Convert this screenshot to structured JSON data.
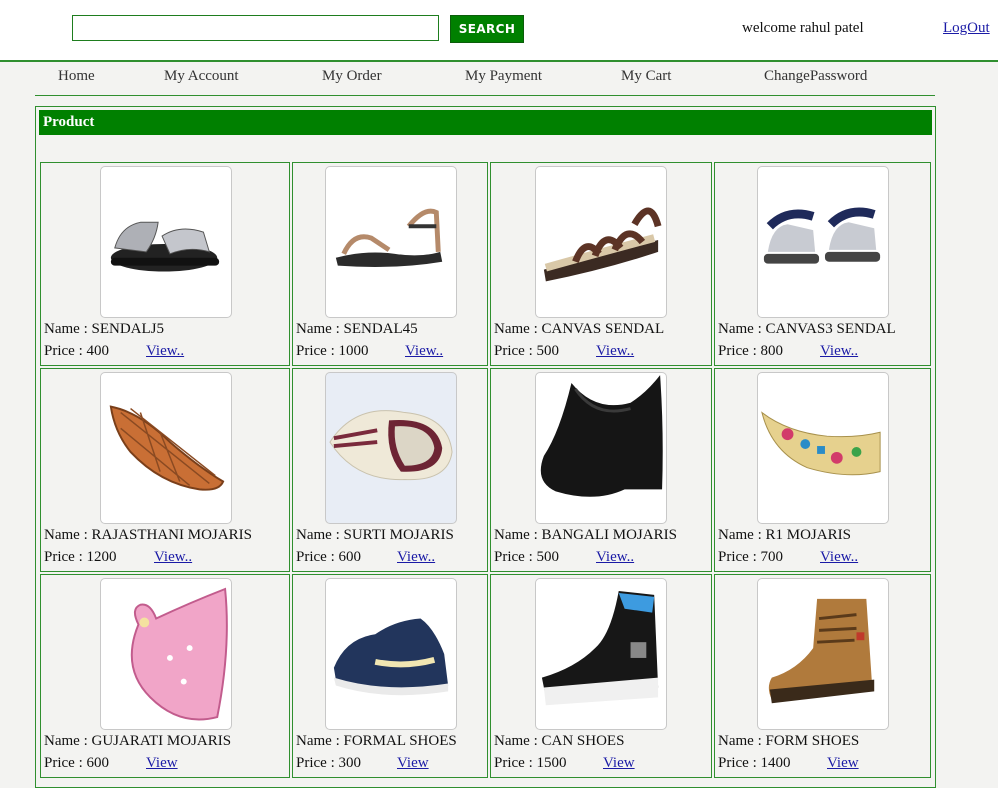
{
  "header": {
    "search": {
      "value": "",
      "placeholder": ""
    },
    "search_button": "SEARCH",
    "welcome": "welcome rahul patel",
    "logout": "LogOut"
  },
  "nav": {
    "items": [
      "Home",
      "My Account",
      "My Order",
      "My Payment",
      "My Cart",
      "ChangePassword"
    ]
  },
  "panel": {
    "title": "Product"
  },
  "labels": {
    "name": "Name : ",
    "price": "Price : ",
    "view": "View.."
  },
  "products": [
    {
      "name": "SENDALJ5",
      "price": "400",
      "view": "View.."
    },
    {
      "name": "SENDAL45",
      "price": "1000",
      "view": "View.."
    },
    {
      "name": "CANVAS SENDAL",
      "price": "500",
      "view": "View.."
    },
    {
      "name": "CANVAS3 SENDAL",
      "price": "800",
      "view": "View.."
    },
    {
      "name": "RAJASTHANI MOJARIS",
      "price": "1200",
      "view": "View.."
    },
    {
      "name": "SURTI MOJARIS",
      "price": "600",
      "view": "View.."
    },
    {
      "name": "BANGALI MOJARIS",
      "price": "500",
      "view": "View.."
    },
    {
      "name": "R1 MOJARIS",
      "price": "700",
      "view": "View.."
    },
    {
      "name": "GUJARATI MOJARIS",
      "price": "600",
      "view": "View"
    },
    {
      "name": "FORMAL SHOES",
      "price": "300",
      "view": "View"
    },
    {
      "name": "CAN SHOES",
      "price": "1500",
      "view": "View"
    },
    {
      "name": "FORM SHOES",
      "price": "1400",
      "view": "View"
    }
  ],
  "colors": {
    "accent": "#008000",
    "border": "#2f8f2f",
    "link": "#1a1aa6",
    "background": "#f3f3f1"
  }
}
